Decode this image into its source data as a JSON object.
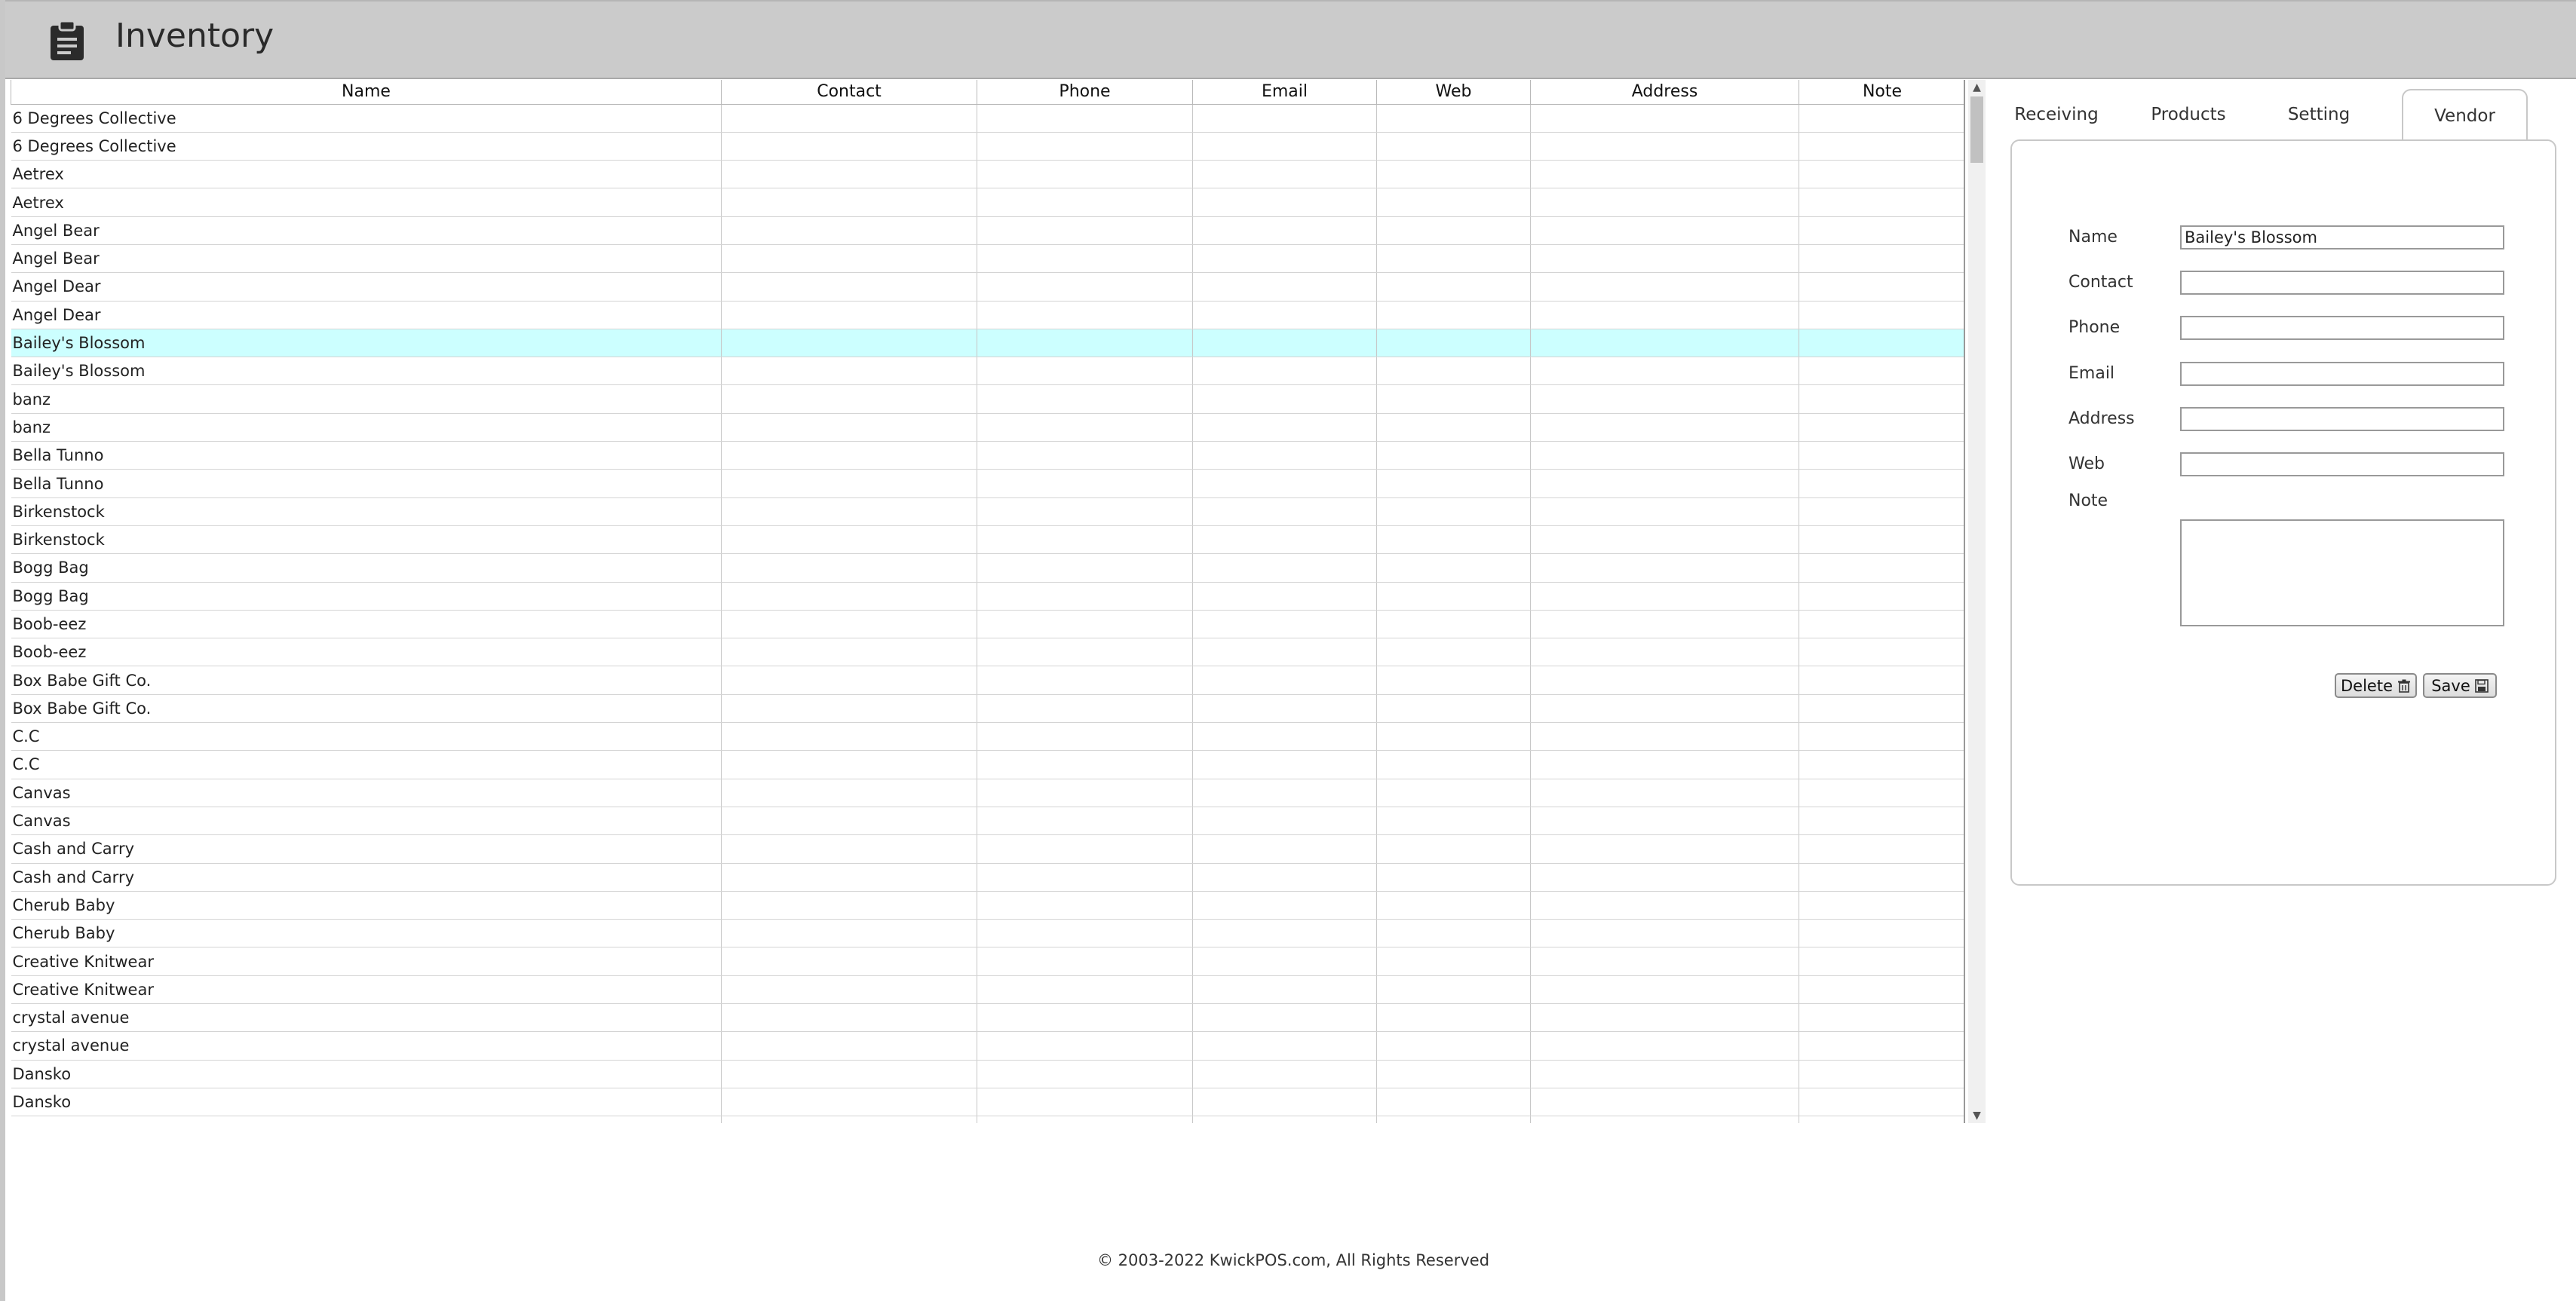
{
  "app": {
    "title": "Inventory"
  },
  "grid": {
    "columns": [
      "Name",
      "Contact",
      "Phone",
      "Email",
      "Web",
      "Address",
      "Note"
    ],
    "rows": [
      "6 Degrees Collective",
      "6 Degrees Collective",
      "Aetrex",
      "Aetrex",
      "Angel Bear",
      "Angel Bear",
      "Angel Dear",
      "Angel Dear",
      "Bailey's Blossom",
      "Bailey's Blossom",
      "banz",
      "banz",
      "Bella Tunno",
      "Bella Tunno",
      "Birkenstock",
      "Birkenstock",
      "Bogg Bag",
      "Bogg Bag",
      "Boob-eez",
      "Boob-eez",
      "Box Babe Gift Co.",
      "Box Babe Gift Co.",
      "C.C",
      "C.C",
      "Canvas",
      "Canvas",
      "Cash and Carry",
      "Cash and Carry",
      "Cherub Baby",
      "Cherub Baby",
      "Creative Knitwear",
      "Creative Knitwear",
      "crystal avenue",
      "crystal avenue",
      "Dansko",
      "Dansko",
      ""
    ],
    "selected_index": 8
  },
  "tabs": [
    {
      "label": "Receiving"
    },
    {
      "label": "Products"
    },
    {
      "label": "Setting"
    },
    {
      "label": "Vendor"
    }
  ],
  "active_tab": "Vendor",
  "form": {
    "name_label": "Name",
    "name_value": "Bailey's Blossom",
    "contact_label": "Contact",
    "contact_value": "",
    "phone_label": "Phone",
    "phone_value": "",
    "email_label": "Email",
    "email_value": "",
    "address_label": "Address",
    "address_value": "",
    "web_label": "Web",
    "web_value": "",
    "note_label": "Note",
    "note_value": "",
    "delete_label": "Delete",
    "save_label": "Save"
  },
  "footer": {
    "text": "© 2003-2022 KwickPOS.com, All Rights Reserved"
  },
  "colors": {
    "header_bg": "#cbcbcb",
    "selected_row": "#ccffff"
  },
  "icons": {
    "logo": "clipboard-icon",
    "delete": "trash-icon",
    "save": "floppy-disk-icon"
  }
}
